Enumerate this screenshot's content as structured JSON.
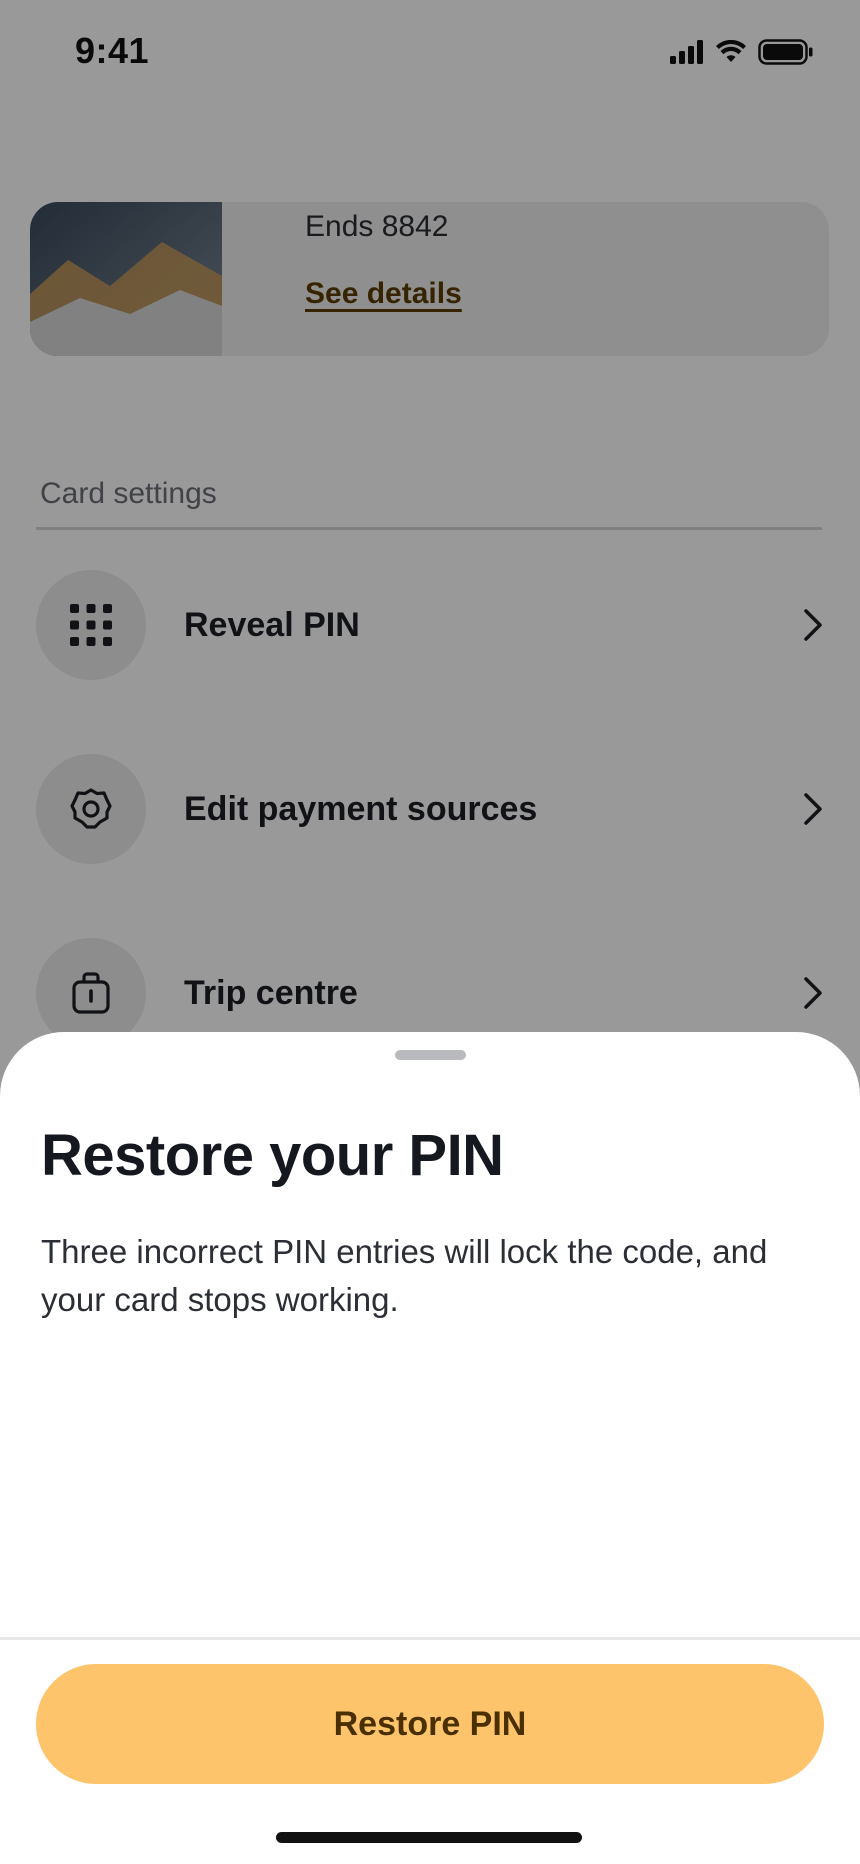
{
  "status_bar": {
    "time": "9:41"
  },
  "card": {
    "ends_text": "Ends 8842",
    "details_link": "See details"
  },
  "settings": {
    "section_label": "Card settings",
    "items": [
      {
        "label": "Reveal PIN",
        "icon": "keypad-icon"
      },
      {
        "label": "Edit payment sources",
        "icon": "gear-icon"
      },
      {
        "label": "Trip centre",
        "icon": "luggage-icon"
      }
    ]
  },
  "sheet": {
    "title": "Restore your PIN",
    "body": "Three incorrect PIN entries will lock the code, and your card stops working.",
    "button_label": "Restore PIN"
  },
  "colors": {
    "accent_button": "#fec46b",
    "button_text": "#4a2f00",
    "link_text": "#5a3d00"
  }
}
